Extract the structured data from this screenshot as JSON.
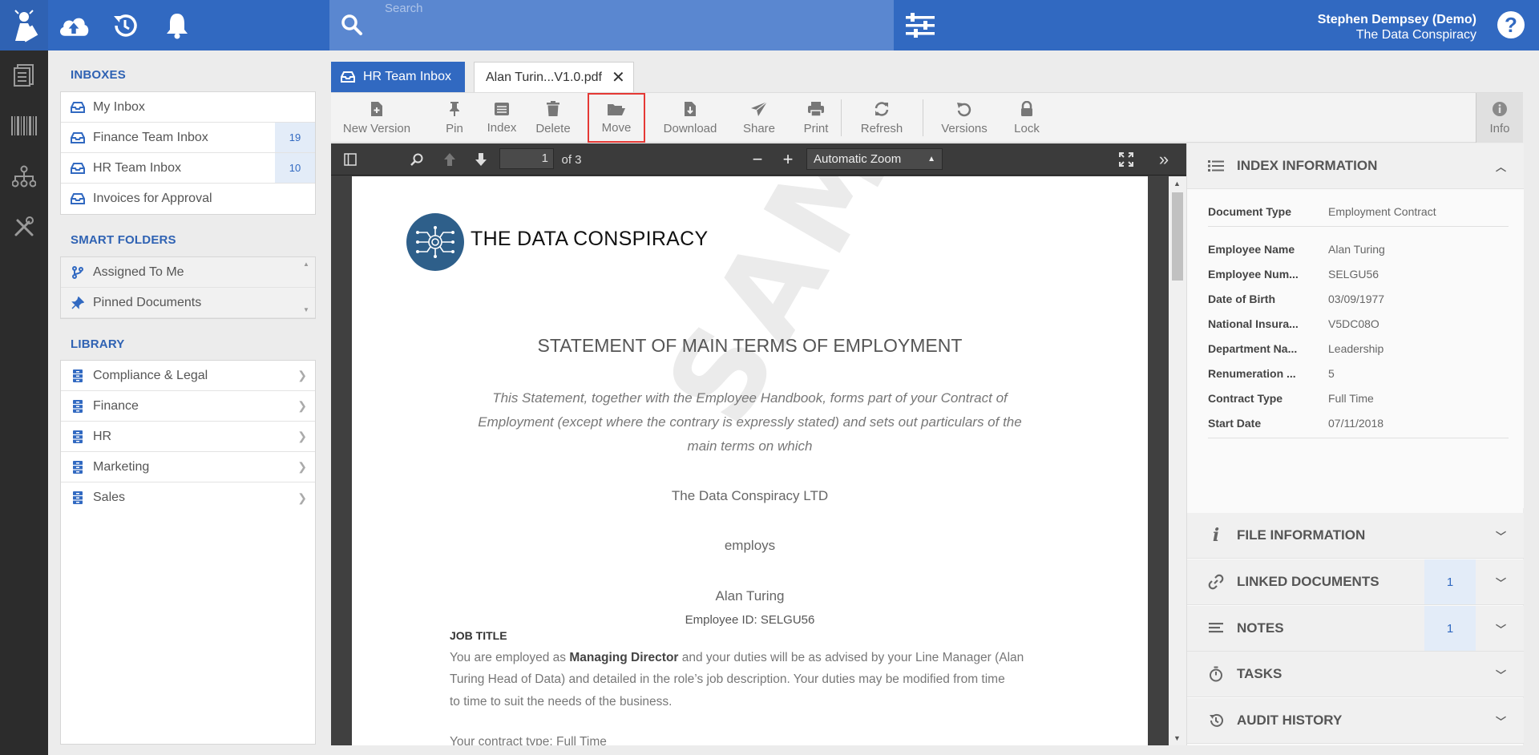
{
  "app": {
    "search_placeholder": "Search",
    "user_name": "Stephen Dempsey (Demo)",
    "user_org": "The Data Conspiracy",
    "help_label": "?"
  },
  "sidebar": {
    "inboxes_title": "INBOXES",
    "inboxes": [
      {
        "label": "My Inbox",
        "count": ""
      },
      {
        "label": "Finance Team Inbox",
        "count": "19"
      },
      {
        "label": "HR Team Inbox",
        "count": "10"
      },
      {
        "label": "Invoices for Approval",
        "count": ""
      }
    ],
    "smart_title": "SMART FOLDERS",
    "smart": [
      {
        "label": "Assigned To Me"
      },
      {
        "label": "Pinned Documents"
      }
    ],
    "library_title": "LIBRARY",
    "library": [
      {
        "label": "Compliance & Legal"
      },
      {
        "label": "Finance"
      },
      {
        "label": "HR"
      },
      {
        "label": "Marketing"
      },
      {
        "label": "Sales"
      }
    ]
  },
  "tabs": {
    "inbox_tab": "HR Team Inbox",
    "doc_tab": "Alan Turin...V1.0.pdf",
    "close": "✕"
  },
  "toolbar": {
    "new_version": "New Version",
    "pin": "Pin",
    "index": "Index",
    "delete": "Delete",
    "move": "Move",
    "download": "Download",
    "share": "Share",
    "print": "Print",
    "refresh": "Refresh",
    "versions": "Versions",
    "lock": "Lock",
    "info": "Info"
  },
  "viewer": {
    "page_current": "1",
    "page_total": "of 3",
    "zoom": "Automatic Zoom"
  },
  "document": {
    "company_logo_text": "THE DATA CONSPIRACY",
    "heading": "STATEMENT OF MAIN TERMS OF EMPLOYMENT",
    "intro_line1": "This Statement, together with the Employee Handbook, forms part of your Contract of",
    "intro_line2": "Employment (except where the contrary is expressly stated) and sets out particulars of the",
    "intro_line3": "main terms on which",
    "employer": "The Data Conspiracy LTD",
    "employs": "employs",
    "employee": "Alan Turing",
    "employee_id": "Employee ID: SELGU56",
    "job_title_heading": "JOB TITLE",
    "job_line1_a": "You are employed as ",
    "job_line1_b": "Managing Director",
    "job_line1_c": " and your duties will be as advised by your Line Manager (Alan",
    "job_line2": "Turing Head of Data) and detailed in the role’s job description. Your duties may be modified from time",
    "job_line3": "to time to suit the needs of the business.",
    "contract_line": "Your contract type: Full Time",
    "watermark": "SAMPLE DATA"
  },
  "info_panel": {
    "index_title": "INDEX INFORMATION",
    "fields": [
      {
        "key": "Document Type",
        "value": "Employment Contract"
      },
      {
        "key": "Employee Name",
        "value": "Alan Turing"
      },
      {
        "key": "Employee Num...",
        "value": "SELGU56"
      },
      {
        "key": "Date of Birth",
        "value": "03/09/1977"
      },
      {
        "key": "National Insura...",
        "value": "V5DC08O"
      },
      {
        "key": "Department Na...",
        "value": "Leadership"
      },
      {
        "key": "Renumeration ...",
        "value": "5"
      },
      {
        "key": "Contract Type",
        "value": "Full Time"
      },
      {
        "key": "Start Date",
        "value": "07/11/2018"
      }
    ],
    "file_info_title": "FILE INFORMATION",
    "linked_title": "LINKED DOCUMENTS",
    "linked_count": "1",
    "notes_title": "NOTES",
    "notes_count": "1",
    "tasks_title": "TASKS",
    "audit_title": "AUDIT HISTORY"
  },
  "colors": {
    "brand_blue": "#3169c1",
    "highlight_red": "#e53935"
  }
}
